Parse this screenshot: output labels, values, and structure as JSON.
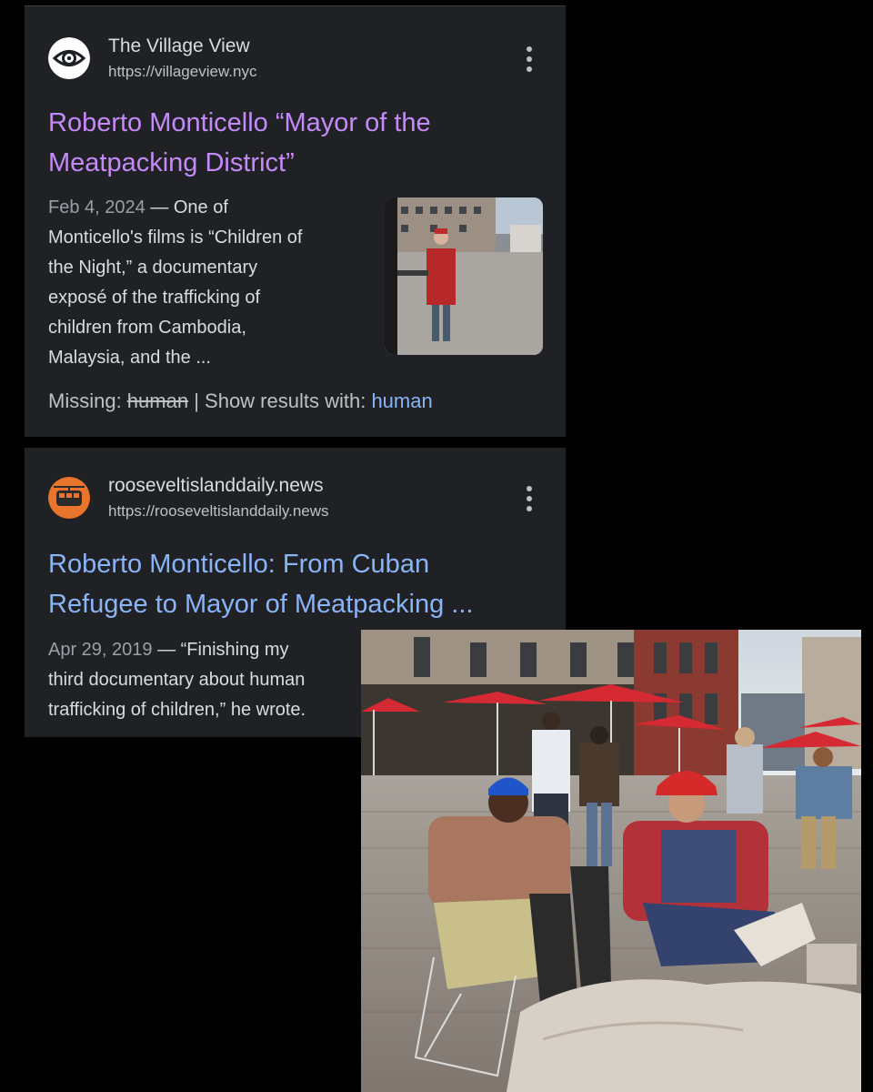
{
  "results": [
    {
      "site_name": "The Village View",
      "site_url": "https://villageview.nyc",
      "favicon": "eye-icon",
      "title_line1": "Roberto Monticello “Mayor of the",
      "title_line2": "Meatpacking District”",
      "date": "Feb 4, 2024",
      "snippet_lines": [
        " — One of",
        "Monticello's films is “Children of",
        "the Night,” a documentary",
        "exposé of the trafficking of",
        "children from Cambodia,",
        "Malaysia, and the ..."
      ],
      "missing_label": "Missing: ",
      "missing_term": "human",
      "separator": " | ",
      "show_results_label": "Show results with: ",
      "show_results_term": "human"
    },
    {
      "site_name": "rooseveltislanddaily.news",
      "site_url": "https://rooseveltislanddaily.news",
      "favicon": "tram-icon",
      "title_line1": "Roberto Monticello: From Cuban",
      "title_line2": "Refugee to Mayor of Meatpacking ...",
      "date": "Apr 29, 2019",
      "snippet_lines": [
        " — “Finishing my",
        "third documentary about human",
        "trafficking of children,” he wrote."
      ]
    }
  ],
  "colors": {
    "card_bg": "#202124",
    "visited_link": "#c58af9",
    "link": "#8ab4f8",
    "text": "#dadce0",
    "muted": "#9aa0a6"
  }
}
